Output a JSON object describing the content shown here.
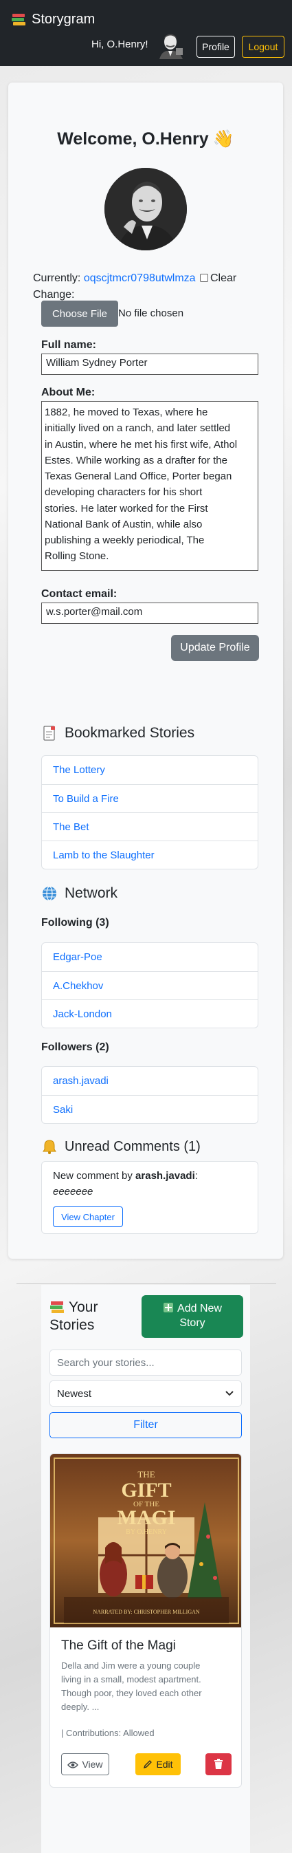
{
  "navbar": {
    "brand": "Storygram",
    "greeting": "Hi, O.Henry!",
    "profile_label": "Profile",
    "logout_label": "Logout"
  },
  "profile": {
    "welcome": "Welcome, O.Henry",
    "currently_label": "Currently:",
    "current_file": "oqscjtmcr0798utwlmza",
    "clear_label": "Clear",
    "change_label": "Change:",
    "choose_file_label": "Choose File",
    "no_file_label": "No file chosen",
    "full_name_label": "Full name:",
    "full_name_value": "William Sydney Porter",
    "about_label": "About Me:",
    "about_lines": [
      "1882, he moved to Texas, where he",
      "initially lived on a ranch, and later settled",
      "in Austin, where he met his first wife, Athol",
      "Estes. While working as a drafter for the",
      "Texas General Land Office, Porter began",
      "developing characters for his short",
      "stories. He later worked for the First",
      "National Bank of Austin, while also",
      "publishing a weekly periodical, The",
      "Rolling Stone."
    ],
    "email_label": "Contact email:",
    "email_value": "w.s.porter@mail.com",
    "update_label": "Update Profile"
  },
  "bookmarks": {
    "title": "Bookmarked Stories",
    "items": [
      "The Lottery",
      "To Build a Fire",
      "The Bet",
      "Lamb to the Slaughter"
    ]
  },
  "network": {
    "title": "Network",
    "following_label": "Following (3)",
    "following": [
      "Edgar-Poe",
      "A.Chekhov",
      "Jack-London"
    ],
    "followers_label": "Followers (2)",
    "followers": [
      "arash.javadi",
      "Saki"
    ]
  },
  "comments": {
    "title": "Unread Comments (1)",
    "prefix": "New comment by ",
    "author": "arash.javadi",
    "suffix": ":",
    "text": "eeeeeee",
    "button": "View Chapter"
  },
  "stories": {
    "title_line1": "Your",
    "title_line2": "Stories",
    "add_line1": "Add New",
    "add_line2": "Story",
    "search_placeholder": "Search your stories...",
    "sort_value": "Newest",
    "filter_label": "Filter",
    "card": {
      "cover_title_1": "THE",
      "cover_title_2": "GIFT",
      "cover_title_3": "OF THE",
      "cover_title_4": "MAGI",
      "cover_author": "BY O.HENRY",
      "cover_narrator": "NARRATED BY: CHRISTOPHER MILLIGAN",
      "title": "The Gift of the Magi",
      "desc_lines": [
        "Della and Jim were a young couple",
        "living in a small, modest apartment.",
        "Though poor, they loved each other",
        "deeply. ..."
      ],
      "meta": "| Contributions: Allowed",
      "view_label": "View",
      "edit_label": "Edit"
    }
  },
  "colors": {
    "navbar": "#212529",
    "primary": "#0d6efd",
    "success": "#198754",
    "warning": "#ffc107",
    "danger": "#dc3545",
    "secondary": "#6c757d"
  }
}
